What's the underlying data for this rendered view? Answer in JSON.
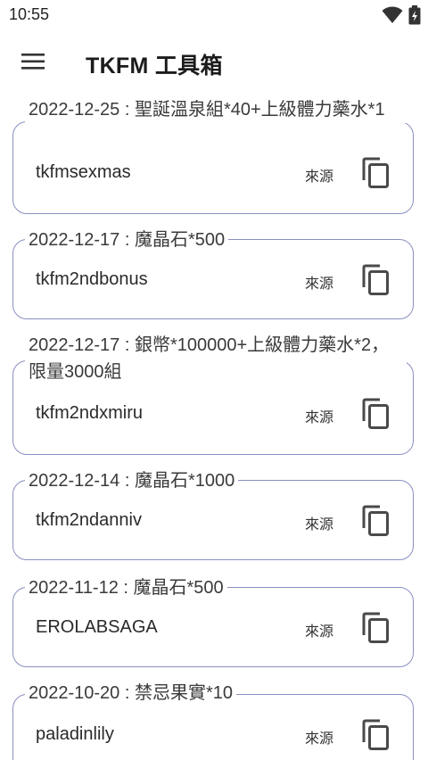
{
  "status": {
    "time": "10:55"
  },
  "app": {
    "title": "TKFM 工具箱"
  },
  "icons": {
    "menu": "hamburger-menu-icon",
    "copy": "copy-icon",
    "wifi": "wifi-icon",
    "signal": "signal-icon",
    "battery": "battery-icon"
  },
  "entries": [
    {
      "label": "2022-12-25 : 聖誕溫泉組*40+上級體力藥水*1",
      "code": "tkfmsexmas",
      "source": "來源"
    },
    {
      "label": "2022-12-17 : 魔晶石*500",
      "code": "tkfm2ndbonus",
      "source": "來源"
    },
    {
      "label": "2022-12-17 : 銀幣*100000+上級體力藥水*2，限量3000組",
      "code": "tkfm2ndxmiru",
      "source": "來源"
    },
    {
      "label": "2022-12-14 : 魔晶石*1000",
      "code": "tkfm2ndanniv",
      "source": "來源"
    },
    {
      "label": "2022-11-12 : 魔晶石*500",
      "code": "EROLABSAGA",
      "source": "來源"
    },
    {
      "label": "2022-10-20 : 禁忌果實*10",
      "code": "paladinlily",
      "source": "來源"
    }
  ],
  "colors": {
    "border": "#8a8fc2",
    "text": "#1f1f1f"
  }
}
